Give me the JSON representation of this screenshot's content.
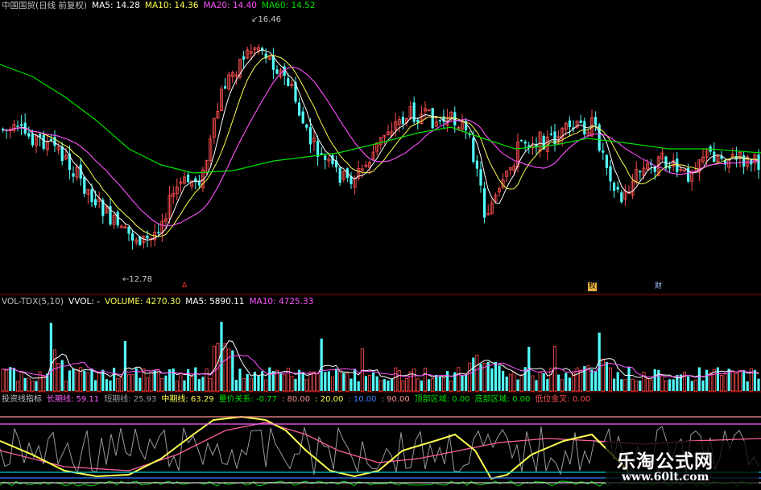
{
  "main_header": {
    "title": "中国国贸(日线 前复权)",
    "ma5": "MA5: 14.28",
    "ma10": "MA10: 14.36",
    "ma20": "MA20: 14.40",
    "ma60": "MA60: 14.52"
  },
  "price_labels": {
    "high": "16.46",
    "low": "12.78"
  },
  "event_markers": {
    "m1": "权",
    "m2": "财"
  },
  "volume_header": {
    "indicator": "VOL-TDX(5,10)",
    "vol": "VVOL: -",
    "volume": "VOLUME: 4270.30",
    "ma5": "MA5: 5890.11",
    "ma10": "MA10: 4725.33"
  },
  "bottom_header": {
    "indicator": "投资线指标",
    "long": "长期线: 59.11",
    "short": "短期线: 25.93",
    "mid": "中期线: 63.29",
    "rel": "量价关系: -0.77",
    "l80": ": 80.00",
    "l20": ": 20.00",
    "l10": ": 10.00",
    "l90": ": 90.00",
    "top": "顶部区域: 0.00",
    "bottom": "底部区域: 0.00",
    "gold": "低位金叉: 0.00"
  },
  "watermark": {
    "title": "乐淘公式网",
    "url": "www.60lt.com"
  },
  "colors": {
    "up": "#ff5050",
    "down": "#54ffff",
    "ma5": "#ffffff",
    "ma10": "#ffff50",
    "ma20": "#ff50ff",
    "ma60": "#00e000",
    "grid": "#b00000"
  }
}
